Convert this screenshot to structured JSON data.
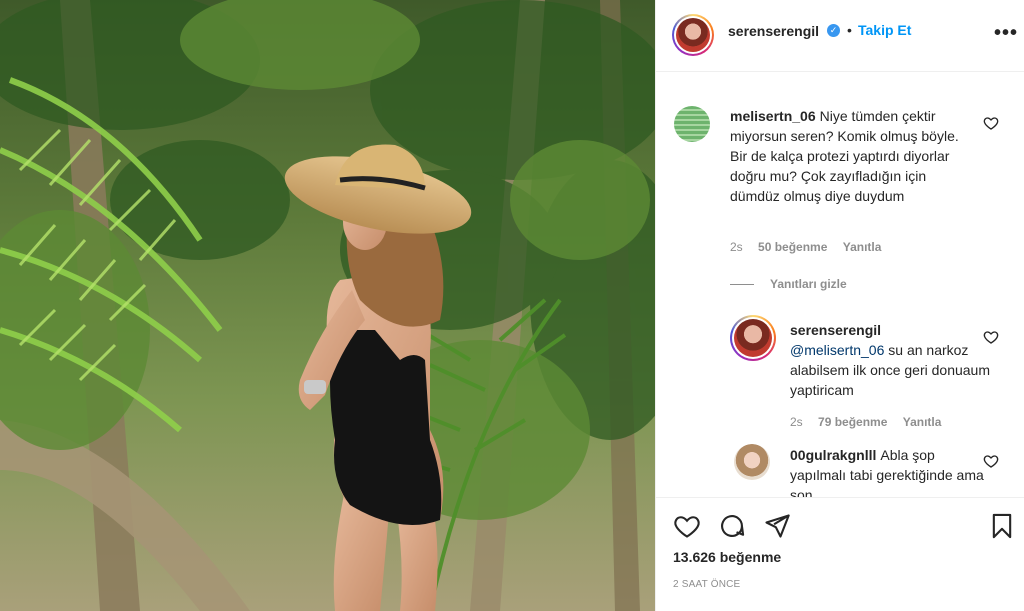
{
  "post": {
    "author": "serenserengil",
    "verified": true,
    "separator": "•",
    "follow_label": "Takip Et",
    "more_icon": "more-options-icon",
    "photo_alt": "photo"
  },
  "comments": [
    {
      "username": "melisertn_06",
      "text": "Niye tümden çektir miyorsun seren? Komik olmuş böyle. Bir de kalça protezi yaptırdı diyorlar doğru mu? Çok zayıfladığın için dümdüz olmuş diye duydum",
      "time": "2s",
      "likes": "50 beğenme",
      "reply_label": "Yanıtla"
    }
  ],
  "hide_replies_label": "Yanıtları gizle",
  "replies": [
    {
      "username": "serenserengil",
      "mention": "@melisertn_06",
      "text": " su an narkoz alabilsem ilk once geri donuaum yaptiricam",
      "time": "2s",
      "likes": "79 beğenme",
      "reply_label": "Yanıtla"
    },
    {
      "username": "00gulrakgnlll",
      "text": "Abla şop yapılmalı tabi gerektiğinde ama son",
      "time": "",
      "likes": "",
      "reply_label": ""
    }
  ],
  "footer": {
    "likes_count": "13.626 beğenme",
    "time_ago": "2 SAAT ÖNCE"
  },
  "colors": {
    "accent": "#0095f6",
    "verified": "#3897f0",
    "muted": "#8e8e8e",
    "text": "#262626"
  }
}
